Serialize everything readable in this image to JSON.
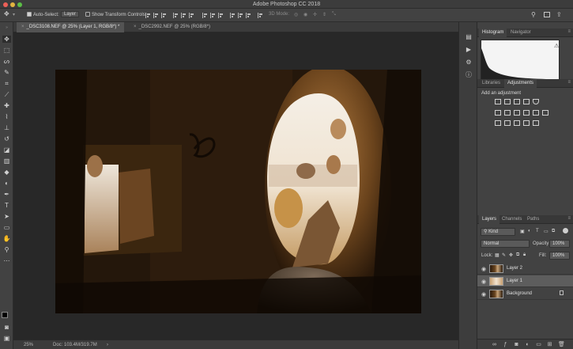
{
  "window": {
    "title": "Adobe Photoshop CC 2018"
  },
  "options_bar": {
    "auto_select_label": "Auto-Select:",
    "auto_select_value": "Layer",
    "show_transform_label": "Show Transform Controls",
    "mode_3d_label": "3D Mode:"
  },
  "tabs": [
    {
      "label": "_DSC3108.NEF @ 25% (Layer 1, RGB/8*) *"
    },
    {
      "label": "_DSC2992.NEF @ 25% (RGB/8*)"
    }
  ],
  "status": {
    "zoom": "25%",
    "doc_size": "Doc: 103.4M/319.7M"
  },
  "panels": {
    "histogram_tab": "Histogram",
    "navigator_tab": "Navigator",
    "libraries_tab": "Libraries",
    "adjustments_tab": "Adjustments",
    "add_adjustment": "Add an adjustment",
    "layers_tab": "Layers",
    "channels_tab": "Channels",
    "paths_tab": "Paths",
    "kind_filter": "Kind",
    "blend_mode": "Normal",
    "opacity_label": "Opacity:",
    "opacity_value": "100%",
    "lock_label": "Lock:",
    "fill_label": "Fill:",
    "fill_value": "100%"
  },
  "layers": [
    {
      "name": "Layer 2",
      "selected": false
    },
    {
      "name": "Layer 1",
      "selected": true
    },
    {
      "name": "Background",
      "selected": false,
      "locked": true
    }
  ],
  "colors": {
    "accent": "#535353",
    "canvas_bg": "#282828"
  }
}
